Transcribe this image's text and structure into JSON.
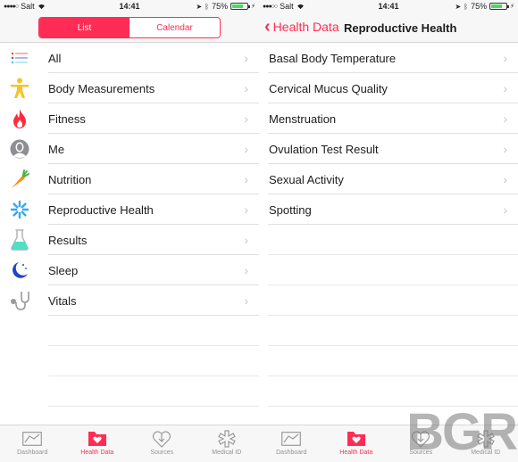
{
  "status_bar_left": {
    "signal": "●●●●○",
    "carrier": "Salt",
    "time": "14:41",
    "battery": "75%",
    "battery_level": 0.75
  },
  "status_bar_right": {
    "signal": "●●●○○",
    "carrier": "Salt",
    "time": "14:41",
    "battery": "75%",
    "battery_level": 0.75
  },
  "left_screen": {
    "segments": [
      {
        "label": "List",
        "active": true
      },
      {
        "label": "Calendar",
        "active": false
      }
    ],
    "categories": [
      {
        "label": "All",
        "icon": "list-icon"
      },
      {
        "label": "Body Measurements",
        "icon": "body-icon"
      },
      {
        "label": "Fitness",
        "icon": "flame-icon"
      },
      {
        "label": "Me",
        "icon": "person-icon"
      },
      {
        "label": "Nutrition",
        "icon": "carrot-icon"
      },
      {
        "label": "Reproductive Health",
        "icon": "snowflake-icon"
      },
      {
        "label": "Results",
        "icon": "flask-icon"
      },
      {
        "label": "Sleep",
        "icon": "moon-icon"
      },
      {
        "label": "Vitals",
        "icon": "stethoscope-icon"
      }
    ]
  },
  "right_screen": {
    "back_label": "Health Data",
    "title": "Reproductive Health",
    "items": [
      {
        "label": "Basal Body Temperature"
      },
      {
        "label": "Cervical Mucus Quality"
      },
      {
        "label": "Menstruation"
      },
      {
        "label": "Ovulation Test Result"
      },
      {
        "label": "Sexual Activity"
      },
      {
        "label": "Spotting"
      }
    ]
  },
  "tab_bar": {
    "tabs": [
      {
        "label": "Dashboard",
        "icon": "dashboard-icon",
        "active": false
      },
      {
        "label": "Health Data",
        "icon": "health-data-icon",
        "active": true
      },
      {
        "label": "Sources",
        "icon": "sources-icon",
        "active": false
      },
      {
        "label": "Medical ID",
        "icon": "medical-id-icon",
        "active": false
      }
    ]
  },
  "chevron": "›",
  "watermark": "BGR",
  "colors": {
    "accent": "#ff2d55",
    "chevron": "#c7c7cc",
    "separator": "#e0e0e0"
  }
}
